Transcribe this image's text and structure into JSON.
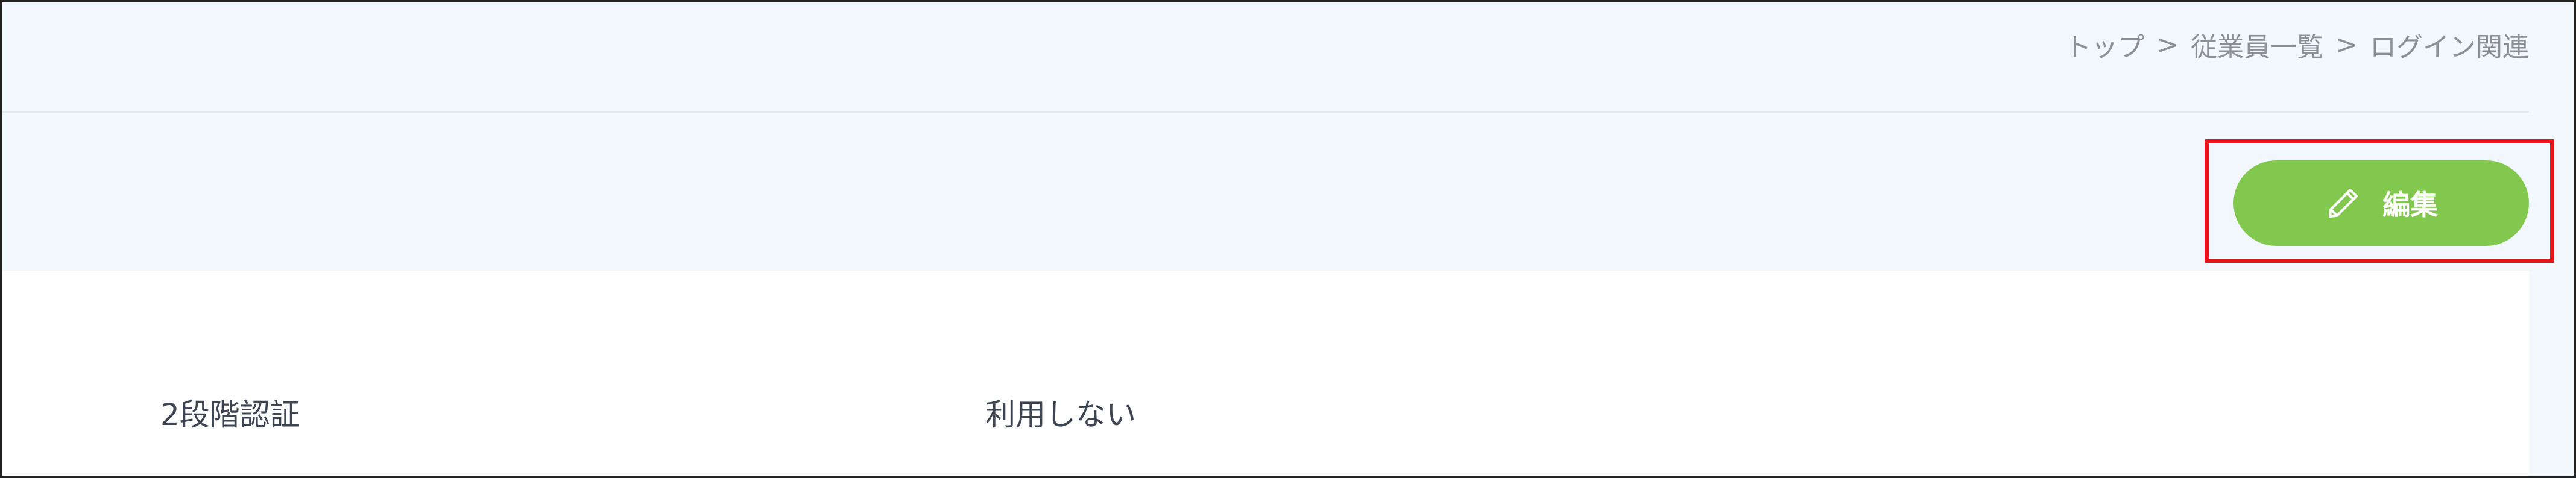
{
  "breadcrumb": {
    "items": [
      "トップ",
      "従業員一覧",
      "ログイン関連"
    ],
    "separator": ">"
  },
  "toolbar": {
    "edit_label": "編集",
    "edit_icon": "pencil-icon",
    "edit_color": "#82c84f",
    "highlight_color": "#e8141c"
  },
  "settings": {
    "two_factor": {
      "label": "2段階認証",
      "value": "利用しない"
    }
  }
}
